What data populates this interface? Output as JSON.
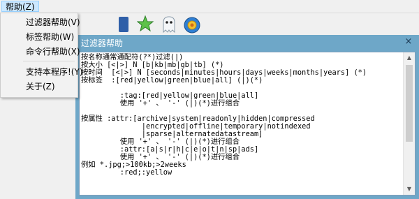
{
  "menubar": {
    "help_label": "帮助(Z)"
  },
  "menu": {
    "items": [
      "过滤器帮助(V)",
      "标签帮助(W)",
      "命令行帮助(X)",
      "支持本程序!(Y)",
      "关于(Z)"
    ]
  },
  "dialog": {
    "title": "过滤器帮助",
    "close_glyph": "×",
    "lines": [
      "按名称通常通配符(?*)过滤(|)",
      "按大小 [<|>] N [b|kb|mb|gb|tb] (*)",
      "按时间  [<|>] N [seconds|minutes|hours|days|weeks|months|years] (*)",
      "按标签  :[red|yellow|green|blue|all] (|)(*)",
      "",
      "         :tag:[red|yellow|green|blue|all]",
      "         使用 '+' 、 '-' (|)(*)进行组合",
      "",
      "按属性 :attr:[archive|system|readonly|hidden|compressed",
      "              |encrypted|offline|temporary|notindexed",
      "              |sparse|alternatedatastream]",
      "         使用 '+' 、 '-' (|)(*)进行组合",
      "         :attr:[a|s|r|h|c|e|o|t|n|sp|ads]",
      "         使用 '+' 、 '-' (|)(*)进行组合",
      "例如 *.jpg;>100kb;>2weeks",
      "         :red;:yellow"
    ]
  },
  "colors": {
    "dialog_frame": "#6ea7c8",
    "menu_highlight": "#cce8ff"
  },
  "icons": [
    "toolbar-blue-icon",
    "star-icon",
    "ghost-icon",
    "gear-icon"
  ]
}
